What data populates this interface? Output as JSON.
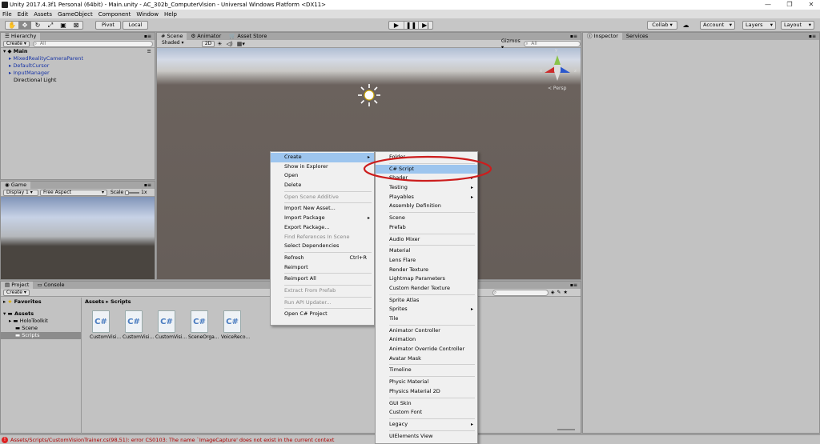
{
  "titlebar": {
    "title": "Unity 2017.4.3f1 Personal (64bit) - Main.unity - AC_302b_ComputerVision - Universal Windows Platform <DX11>",
    "minimize": "—",
    "maximize": "❐",
    "close": "✕"
  },
  "menubar": [
    "File",
    "Edit",
    "Assets",
    "GameObject",
    "Component",
    "Window",
    "Help"
  ],
  "toolbar": {
    "pivot": "Pivot",
    "local": "Local",
    "collab": "Collab ▾",
    "account": "Account",
    "layers": "Layers",
    "layout": "Layout"
  },
  "hierarchy": {
    "tab": "Hierarchy",
    "create": "Create ▾",
    "search_placeholder": "All",
    "scene": "Main",
    "items": [
      "MixedRealityCameraParent",
      "DefaultCursor",
      "InputManager",
      "Directional Light"
    ]
  },
  "scene_tabs": {
    "scene": "Scene",
    "animator": "Animator",
    "asset_store": "Asset Store"
  },
  "scene_bar": {
    "shaded": "Shaded",
    "mode2d": "2D",
    "gizmos": "Gizmos ▾",
    "search_placeholder": "All"
  },
  "scene_view": {
    "persp": "< Persp",
    "axis_y": "y",
    "axis_x": "x",
    "axis_z": "z"
  },
  "game": {
    "tab": "Game",
    "display": "Display 1",
    "aspect": "Free Aspect",
    "scale_label": "Scale",
    "scale_value": "1x"
  },
  "inspector": {
    "tab": "Inspector",
    "services": "Services"
  },
  "project": {
    "tab": "Project",
    "console": "Console",
    "create": "Create ▾",
    "favorites": "Favorites",
    "assets": "Assets",
    "folders": [
      "HoloToolkit",
      "Scene",
      "Scripts"
    ],
    "breadcrumb": "Assets ▸ Scripts",
    "files": [
      "CustomVisi...",
      "CustomVisi...",
      "CustomVisi...",
      "SceneOrga...",
      "VoiceReco..."
    ],
    "file_glyph": "C#"
  },
  "context_menu": {
    "items": [
      {
        "label": "Create",
        "arrow": "▸",
        "highlight": true
      },
      {
        "label": "Show in Explorer"
      },
      {
        "label": "Open"
      },
      {
        "label": "Delete"
      },
      {
        "sep": true
      },
      {
        "label": "Open Scene Additive",
        "disabled": true
      },
      {
        "sep": true
      },
      {
        "label": "Import New Asset..."
      },
      {
        "label": "Import Package",
        "arrow": "▸"
      },
      {
        "label": "Export Package..."
      },
      {
        "label": "Find References In Scene",
        "disabled": true
      },
      {
        "label": "Select Dependencies"
      },
      {
        "sep": true
      },
      {
        "label": "Refresh",
        "shortcut": "Ctrl+R"
      },
      {
        "label": "Reimport"
      },
      {
        "sep": true
      },
      {
        "label": "Reimport All"
      },
      {
        "sep": true
      },
      {
        "label": "Extract From Prefab",
        "disabled": true
      },
      {
        "sep": true
      },
      {
        "label": "Run API Updater...",
        "disabled": true
      },
      {
        "sep": true
      },
      {
        "label": "Open C# Project"
      }
    ]
  },
  "create_submenu": {
    "items": [
      {
        "label": "Folder"
      },
      {
        "sep": true
      },
      {
        "label": "C# Script",
        "highlight": true
      },
      {
        "label": "Shader",
        "arrow": "▸"
      },
      {
        "label": "Testing",
        "arrow": "▸"
      },
      {
        "label": "Playables",
        "arrow": "▸"
      },
      {
        "label": "Assembly Definition"
      },
      {
        "sep": true
      },
      {
        "label": "Scene"
      },
      {
        "label": "Prefab"
      },
      {
        "sep": true
      },
      {
        "label": "Audio Mixer"
      },
      {
        "sep": true
      },
      {
        "label": "Material"
      },
      {
        "label": "Lens Flare"
      },
      {
        "label": "Render Texture"
      },
      {
        "label": "Lightmap Parameters"
      },
      {
        "label": "Custom Render Texture"
      },
      {
        "sep": true
      },
      {
        "label": "Sprite Atlas"
      },
      {
        "label": "Sprites",
        "arrow": "▸"
      },
      {
        "label": "Tile"
      },
      {
        "sep": true
      },
      {
        "label": "Animator Controller"
      },
      {
        "label": "Animation"
      },
      {
        "label": "Animator Override Controller"
      },
      {
        "label": "Avatar Mask"
      },
      {
        "sep": true
      },
      {
        "label": "Timeline"
      },
      {
        "sep": true
      },
      {
        "label": "Physic Material"
      },
      {
        "label": "Physics Material 2D"
      },
      {
        "sep": true
      },
      {
        "label": "GUI Skin"
      },
      {
        "label": "Custom Font"
      },
      {
        "sep": true
      },
      {
        "label": "Legacy",
        "arrow": "▸"
      },
      {
        "sep": true
      },
      {
        "label": "UIElements View"
      }
    ]
  },
  "statusbar": {
    "error": "Assets/Scripts/CustomVisionTrainer.cs(98,51): error CS0103: The name `ImageCapture' does not exist in the current context"
  },
  "colors": {
    "highlight": "#9dc5ee",
    "annotation": "#cc1d1d",
    "scene_bg": "#665e59",
    "link_blue": "#1633a6"
  }
}
